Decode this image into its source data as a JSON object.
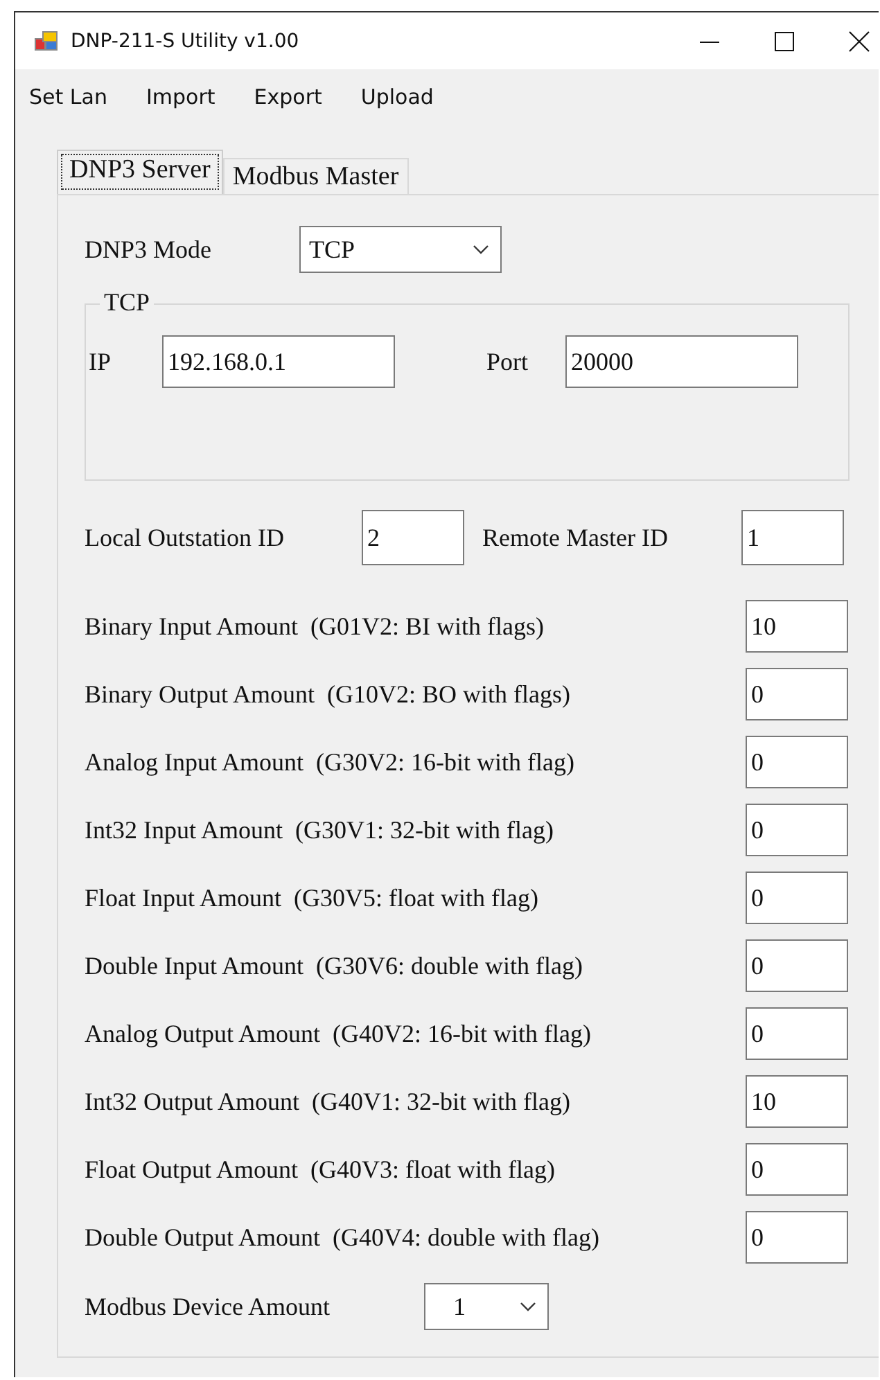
{
  "window": {
    "title": "DNP-211-S Utility v1.00"
  },
  "menu": [
    "Set Lan",
    "Import",
    "Export",
    "Upload"
  ],
  "tabs": [
    {
      "label": "DNP3 Server",
      "selected": true
    },
    {
      "label": "Modbus Master",
      "selected": false
    }
  ],
  "dnp3_mode": {
    "label": "DNP3 Mode",
    "value": "TCP"
  },
  "tcp_group": {
    "title": "TCP",
    "ip_label": "IP",
    "ip": "192.168.0.1",
    "port_label": "Port",
    "port": "20000"
  },
  "ids": {
    "local_label": "Local Outstation ID",
    "local": "2",
    "remote_label": "Remote Master ID",
    "remote": "1"
  },
  "amounts": [
    {
      "label": "Binary Input Amount  (G01V2: BI with flags)",
      "value": "10"
    },
    {
      "label": "Binary Output Amount  (G10V2: BO with flags)",
      "value": "0"
    },
    {
      "label": "Analog Input Amount  (G30V2: 16-bit with flag)",
      "value": "0"
    },
    {
      "label": "Int32 Input Amount  (G30V1: 32-bit with flag)",
      "value": "0"
    },
    {
      "label": "Float Input Amount  (G30V5: float with flag)",
      "value": "0"
    },
    {
      "label": "Double Input Amount  (G30V6: double with flag)",
      "value": "0"
    },
    {
      "label": "Analog Output Amount  (G40V2: 16-bit with flag)",
      "value": "0"
    },
    {
      "label": "Int32 Output Amount  (G40V1: 32-bit with flag)",
      "value": "10"
    },
    {
      "label": "Float Output Amount  (G40V3: float with flag)",
      "value": "0"
    },
    {
      "label": "Double Output Amount  (G40V4: double with flag)",
      "value": "0"
    }
  ],
  "modbus_device_amount": {
    "label": "Modbus Device Amount",
    "value": "1"
  }
}
